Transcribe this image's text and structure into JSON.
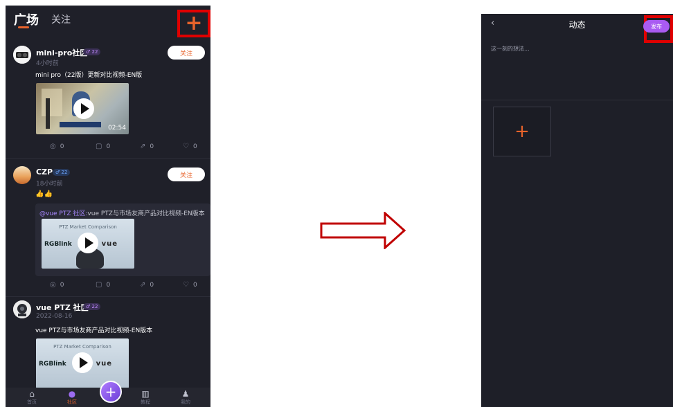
{
  "left": {
    "tabs": {
      "square": "广场",
      "follow": "关注"
    },
    "add_icon": "plus-icon",
    "posts": [
      {
        "user": "mini-pro社区",
        "level": "22",
        "time": "4小时前",
        "follow_label": "关注",
        "text": "mini pro（22版）更新对比视频-EN版",
        "duration": "02:54",
        "stats": {
          "views": "0",
          "comments": "0",
          "shares": "0",
          "likes": "0"
        }
      },
      {
        "user": "CZP",
        "level": "22",
        "time": "18小时前",
        "follow_label": "关注",
        "text": "👍👍",
        "repost": {
          "mention": "@vue PTZ 社区:",
          "text": "vue PTZ与市场友商产品对比视频-EN版本"
        },
        "stats": {
          "views": "0",
          "comments": "0",
          "shares": "0",
          "likes": "0"
        }
      },
      {
        "user": "vue PTZ 社区",
        "level": "22",
        "time": "2022-08-16",
        "text": "vue PTZ与市场友商产品对比视频-EN版本"
      }
    ],
    "video_thumb": {
      "title": "PTZ Market Comparison",
      "logo_left": "RGBlink",
      "logo_right": "vue"
    },
    "nav": [
      {
        "label": "首页",
        "icon": "home-icon"
      },
      {
        "label": "社区",
        "icon": "planet-icon"
      },
      {
        "label": "",
        "icon": "plus-icon"
      },
      {
        "label": "教程",
        "icon": "book-icon"
      },
      {
        "label": "我的",
        "icon": "user-icon"
      }
    ]
  },
  "right": {
    "back_icon": "chevron-left-icon",
    "title": "动态",
    "publish_label": "发布",
    "placeholder": "这一刻的想法...",
    "add_image_icon": "plus-icon"
  },
  "colors": {
    "accent": "#e8632b",
    "purple": "#a95bf2",
    "highlight": "#e00000",
    "background": "#1f2029"
  }
}
